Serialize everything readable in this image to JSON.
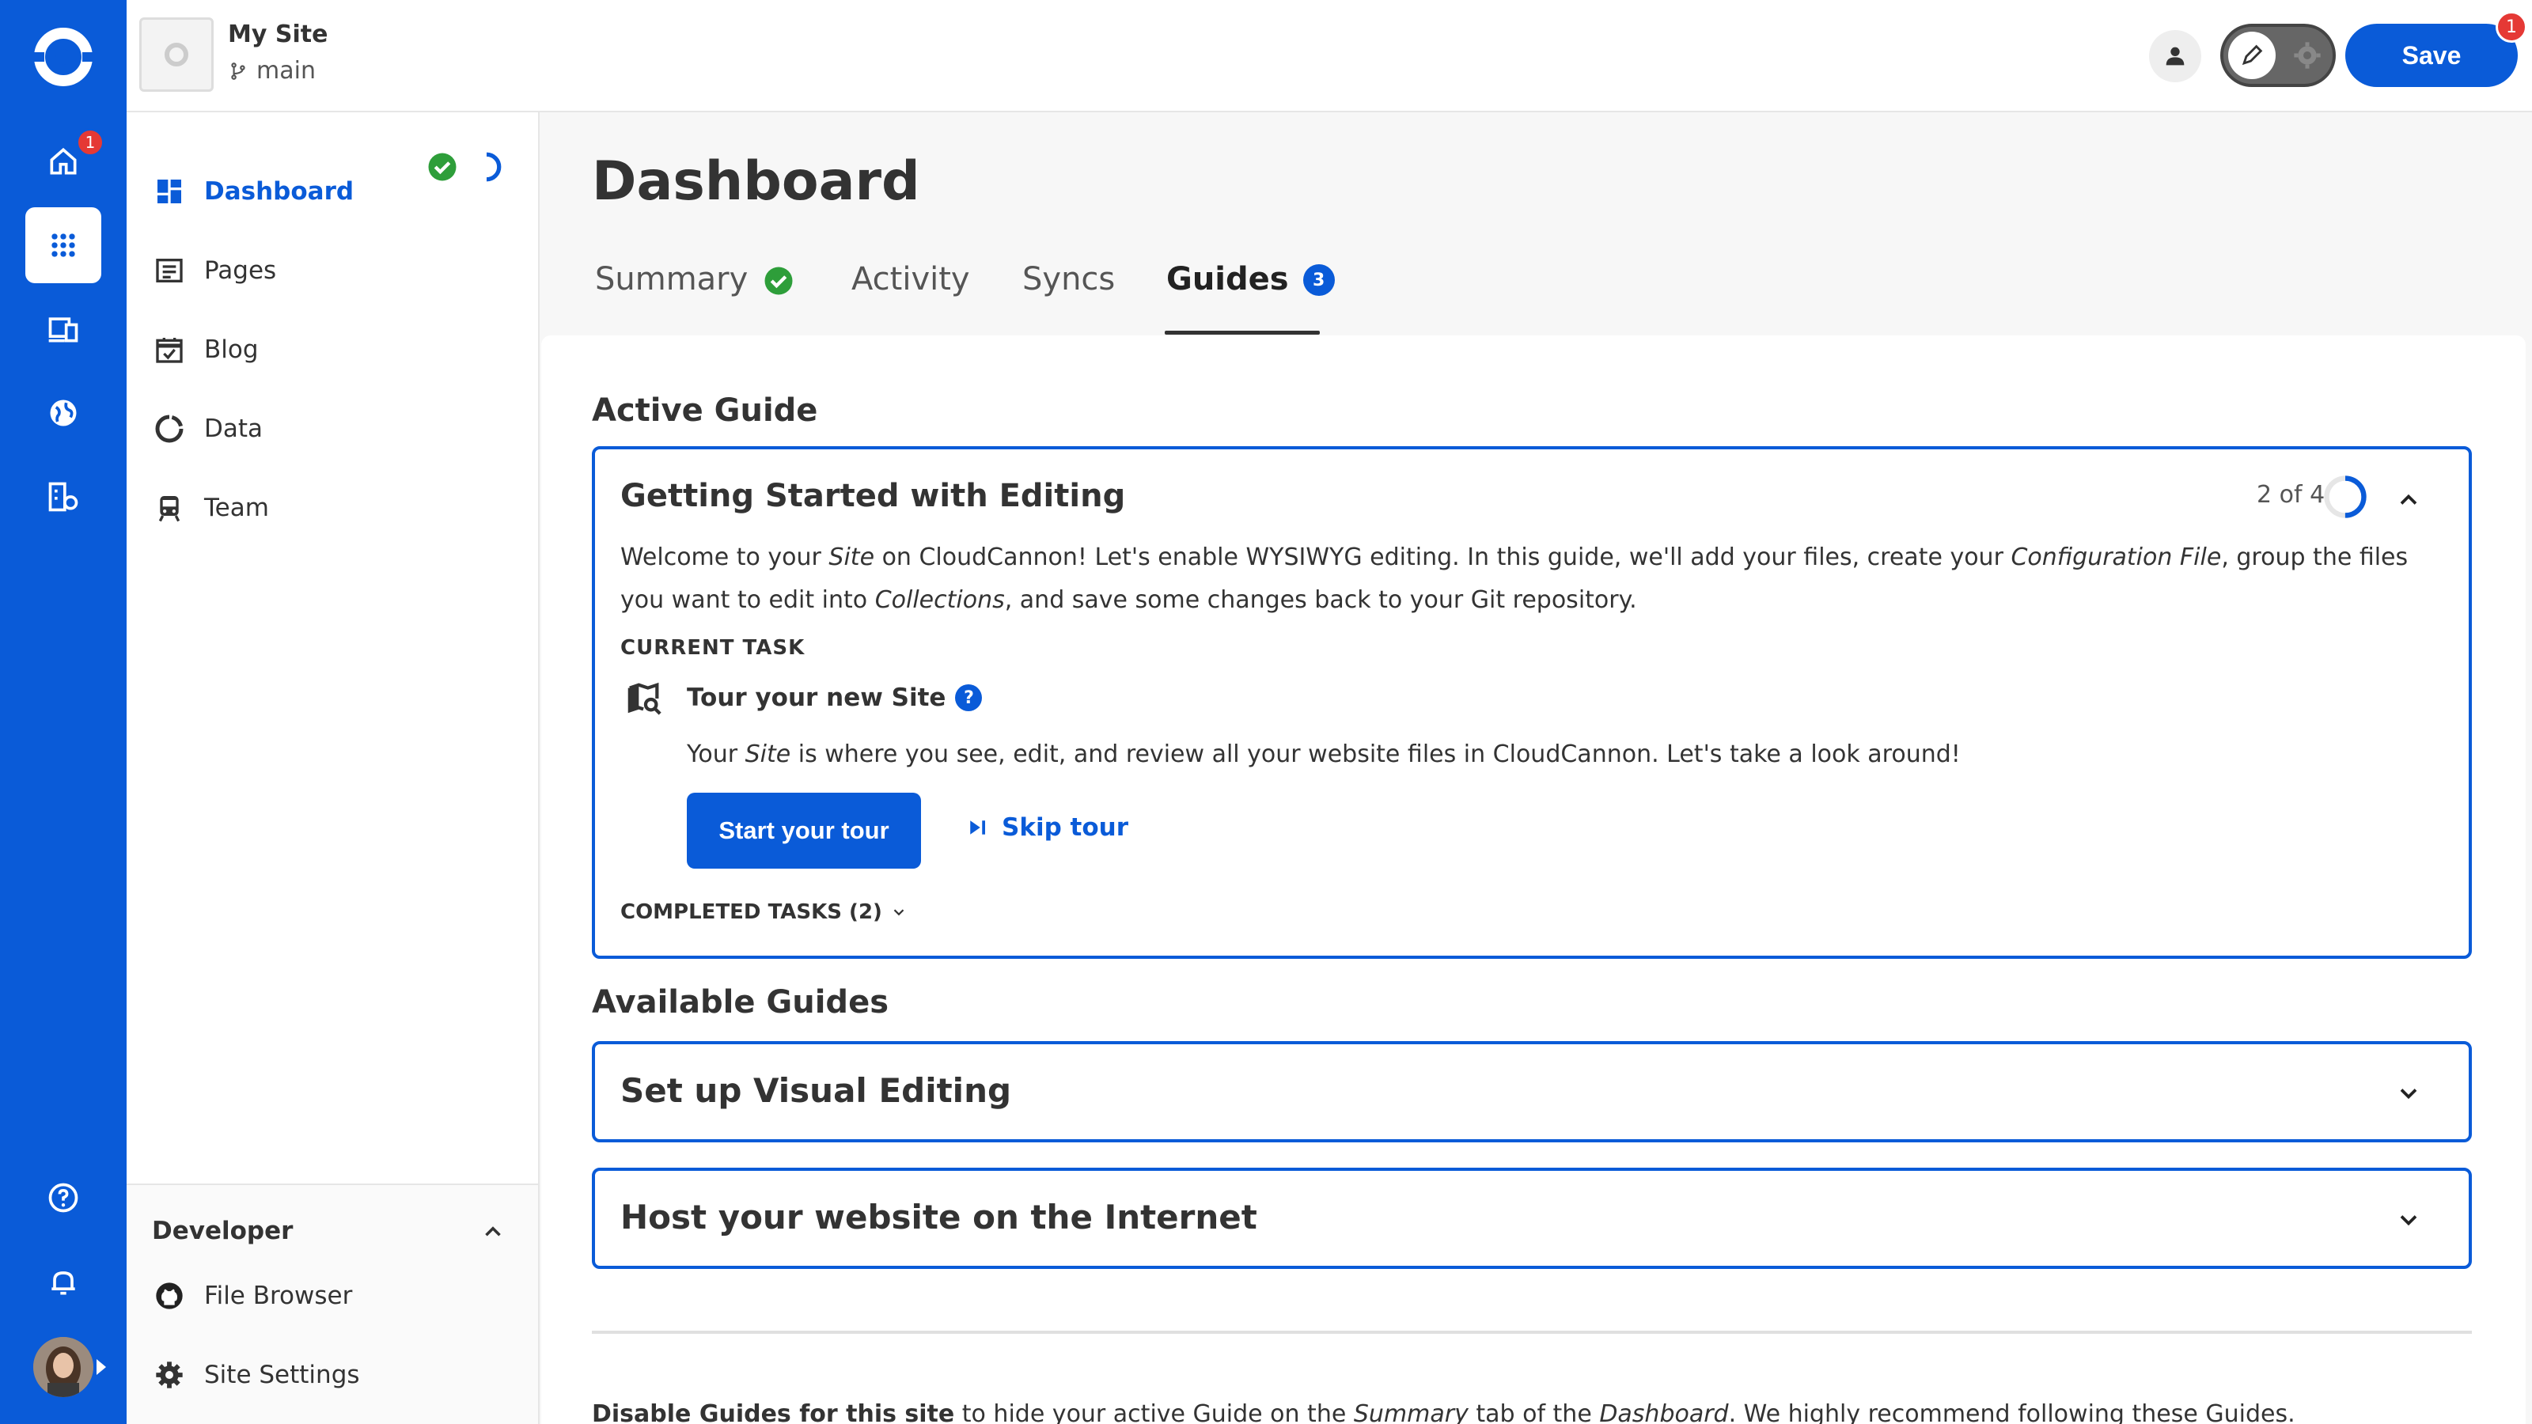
{
  "rail": {
    "home_badge": "1",
    "accent": "#0a5bd8"
  },
  "topbar": {
    "site_name": "My Site",
    "branch": "main",
    "save_label": "Save",
    "save_badge": "1"
  },
  "sidebar": {
    "items": [
      {
        "label": "Dashboard",
        "icon": "dashboard-icon"
      },
      {
        "label": "Pages",
        "icon": "pages-icon"
      },
      {
        "label": "Blog",
        "icon": "blog-icon"
      },
      {
        "label": "Data",
        "icon": "data-icon"
      },
      {
        "label": "Team",
        "icon": "team-icon"
      }
    ],
    "developer": {
      "title": "Developer",
      "items": [
        {
          "label": "File Browser",
          "icon": "github-icon"
        },
        {
          "label": "Site Settings",
          "icon": "gear-icon"
        }
      ]
    }
  },
  "main": {
    "title": "Dashboard",
    "tabs": [
      {
        "label": "Summary"
      },
      {
        "label": "Activity"
      },
      {
        "label": "Syncs"
      },
      {
        "label": "Guides",
        "count": "3"
      }
    ],
    "active_guide_heading": "Active Guide",
    "active_guide": {
      "title": "Getting Started with Editing",
      "progress": "2 of 4",
      "progress_fraction": 0.5,
      "description_parts": [
        "Welcome to your ",
        "Site",
        " on CloudCannon! Let's enable WYSIWYG editing. In this guide, we'll add your files, create your ",
        "Configuration File",
        ", group the files you want to edit into ",
        "Collections",
        ", and save some changes back to your Git repository."
      ],
      "current_task_label": "CURRENT TASK",
      "task_title": "Tour your new Site",
      "task_help": "?",
      "task_desc_parts": [
        "Your ",
        "Site",
        " is where you see, edit, and review all your website files in CloudCannon. Let's take a look around!"
      ],
      "start_label": "Start your tour",
      "skip_label": "Skip tour",
      "completed_label": "COMPLETED TASKS (2)"
    },
    "available_heading": "Available Guides",
    "available_guides": [
      {
        "title": "Set up Visual Editing"
      },
      {
        "title": "Host your website on the Internet"
      }
    ],
    "footer_parts": [
      "Disable Guides for this site",
      " to hide your active Guide on the ",
      "Summary",
      " tab of the ",
      "Dashboard",
      ". We highly recommend following these Guides."
    ]
  }
}
